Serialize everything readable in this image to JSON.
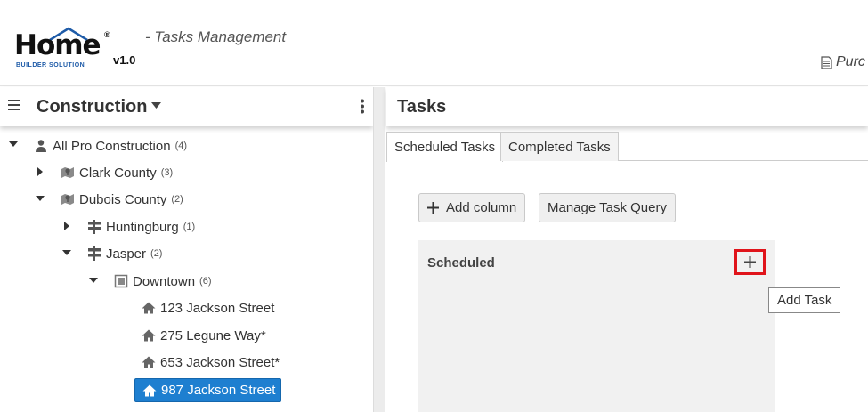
{
  "header": {
    "logo": {
      "word": "Home",
      "registered": "®",
      "tagline": "BUILDER SOLUTION",
      "version": "v1.0"
    },
    "subtitle": "- Tasks Management",
    "purchase_link": "Purc",
    "purchase_icon": "document-icon"
  },
  "sidebar": {
    "title": "Construction",
    "menu_icon": "hamburger-icon",
    "more_icon": "kebab-icon",
    "tree": [
      {
        "label": "All Pro Construction",
        "count": "(4)",
        "icon": "person-icon",
        "expanded": true
      },
      {
        "label": "Clark County",
        "count": "(3)",
        "icon": "map-icon",
        "expanded": false
      },
      {
        "label": "Dubois County",
        "count": "(2)",
        "icon": "map-icon",
        "expanded": true
      },
      {
        "label": "Huntingburg",
        "count": "(1)",
        "icon": "signpost-icon",
        "expanded": false
      },
      {
        "label": "Jasper",
        "count": "(2)",
        "icon": "signpost-icon",
        "expanded": true
      },
      {
        "label": "Downtown",
        "count": "(6)",
        "icon": "building-icon",
        "expanded": true
      },
      {
        "label": "123 Jackson Street",
        "icon": "house-icon"
      },
      {
        "label": "275 Legune Way*",
        "icon": "house-icon"
      },
      {
        "label": "653 Jackson Street*",
        "icon": "house-icon"
      },
      {
        "label": "987 Jackson Street",
        "icon": "house-icon",
        "selected": true
      }
    ]
  },
  "main": {
    "title": "Tasks",
    "tabs": [
      {
        "label": "Scheduled Tasks",
        "active": true
      },
      {
        "label": "Completed Tasks",
        "active": false
      }
    ],
    "toolbar": {
      "add_column_label": "Add column",
      "manage_query_label": "Manage Task Query"
    },
    "column": {
      "title": "Scheduled",
      "add_tooltip": "Add Task"
    }
  },
  "colors": {
    "selected_bg": "#1e7fd0",
    "highlight_border": "#e0141b",
    "logo_blue": "#1e5ba8"
  }
}
